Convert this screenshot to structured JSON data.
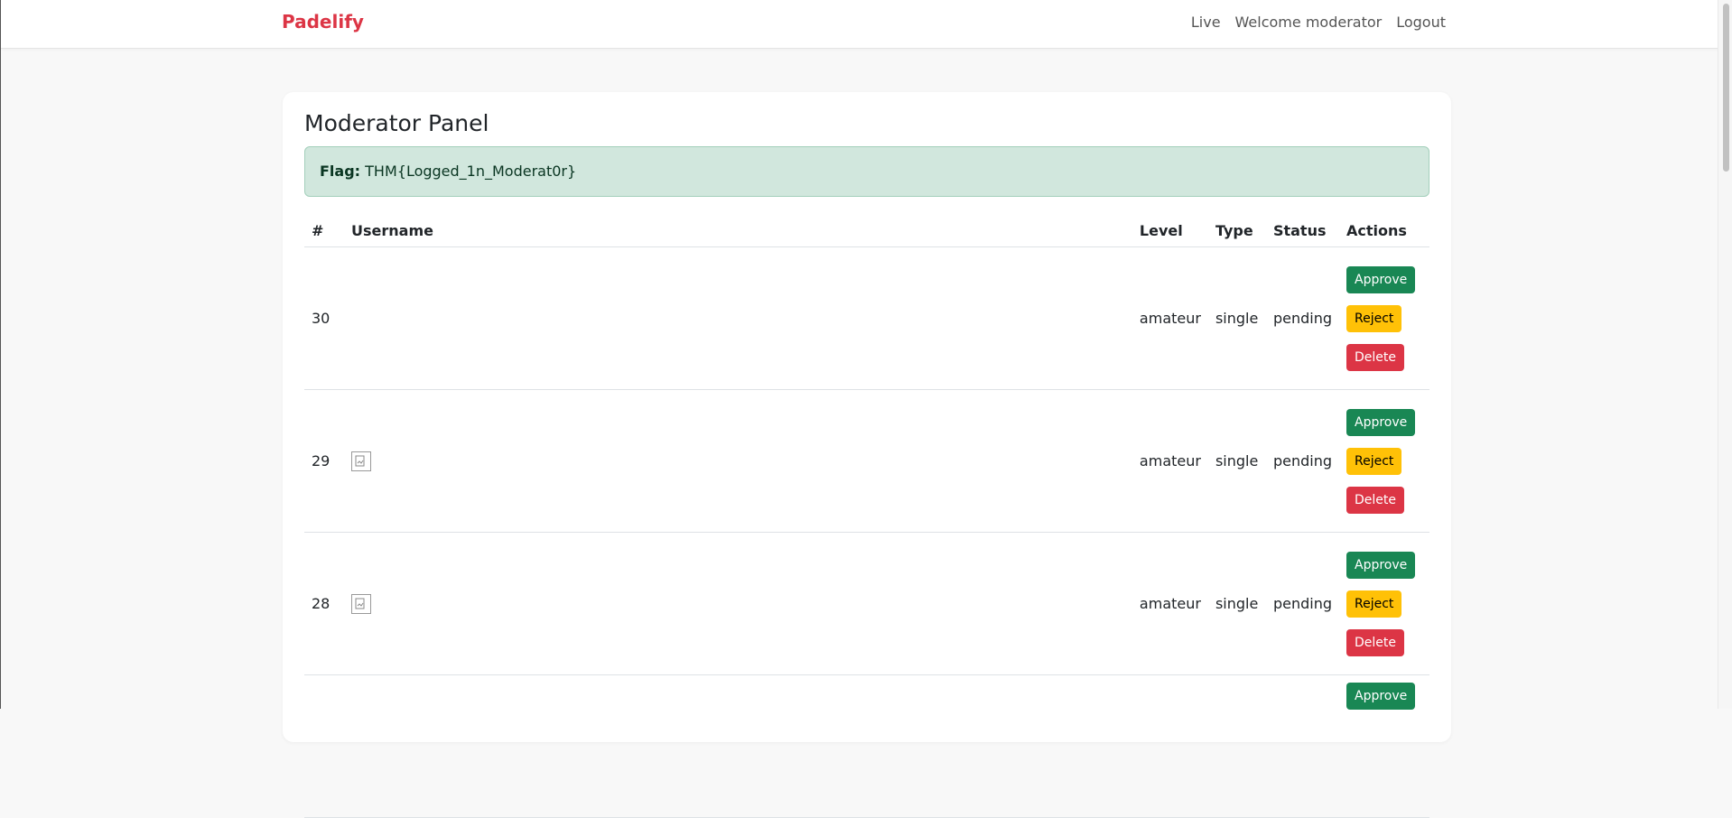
{
  "nav": {
    "brand": "Padelify",
    "links": [
      "Live",
      "Welcome moderator",
      "Logout"
    ]
  },
  "panel": {
    "title": "Moderator Panel",
    "flag_label": "Flag:",
    "flag_value": "THM{Logged_1n_Moderat0r}"
  },
  "table": {
    "headers": [
      "#",
      "Username",
      "Level",
      "Type",
      "Status",
      "Actions"
    ],
    "rows": [
      {
        "id": "30",
        "username_image": "none",
        "level": "amateur",
        "type": "single",
        "status": "pending"
      },
      {
        "id": "29",
        "username_image": "broken-image-icon",
        "level": "amateur",
        "type": "single",
        "status": "pending"
      },
      {
        "id": "28",
        "username_image": "broken-image-icon",
        "level": "amateur",
        "type": "single",
        "status": "pending"
      },
      {
        "id": "",
        "username_image": "",
        "level": "",
        "type": "",
        "status": ""
      }
    ],
    "actions": {
      "approve": "Approve",
      "reject": "Reject",
      "delete": "Delete"
    }
  },
  "colors": {
    "brand": "#dc3545",
    "approve": "#198754",
    "reject": "#ffc107",
    "delete": "#dc3545",
    "alert_bg": "#d1e7dd"
  }
}
